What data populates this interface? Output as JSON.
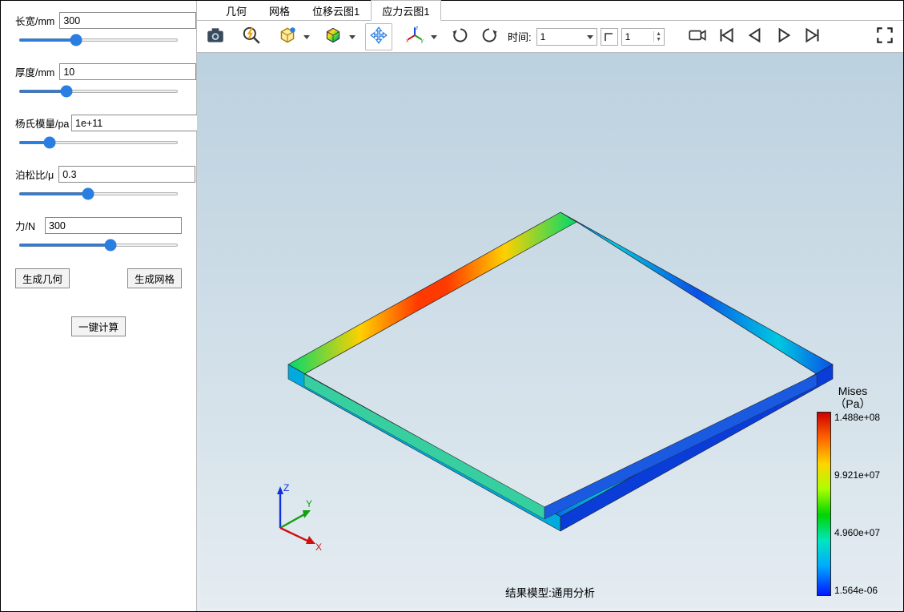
{
  "sidebar": {
    "params": {
      "length": {
        "label": "长宽/mm",
        "value": "300"
      },
      "thickness": {
        "label": "厚度/mm",
        "value": "10"
      },
      "youngs": {
        "label": "杨氏模量/pa",
        "value": "1e+11"
      },
      "poisson": {
        "label": "泊松比/μ",
        "value": "0.3"
      },
      "force": {
        "label": "力/N",
        "value": "300"
      }
    },
    "buttons": {
      "gen_geometry": "生成几何",
      "gen_mesh": "生成网格",
      "compute": "一键计算"
    }
  },
  "tabs": {
    "geometry": "几何",
    "mesh": "网格",
    "disp": "位移云图1",
    "stress": "应力云图1"
  },
  "toolbar": {
    "time_label": "时间:",
    "time_value": "1",
    "step_value": "1"
  },
  "colorbar": {
    "title_line1": "Mises",
    "title_line2": "（Pa）",
    "ticks": [
      "1.488e+08",
      "9.921e+07",
      "4.960e+07",
      "1.564e-06"
    ]
  },
  "viewport": {
    "caption": "结果模型:通用分析",
    "axes": {
      "x": "X",
      "y": "Y",
      "z": "Z"
    }
  }
}
